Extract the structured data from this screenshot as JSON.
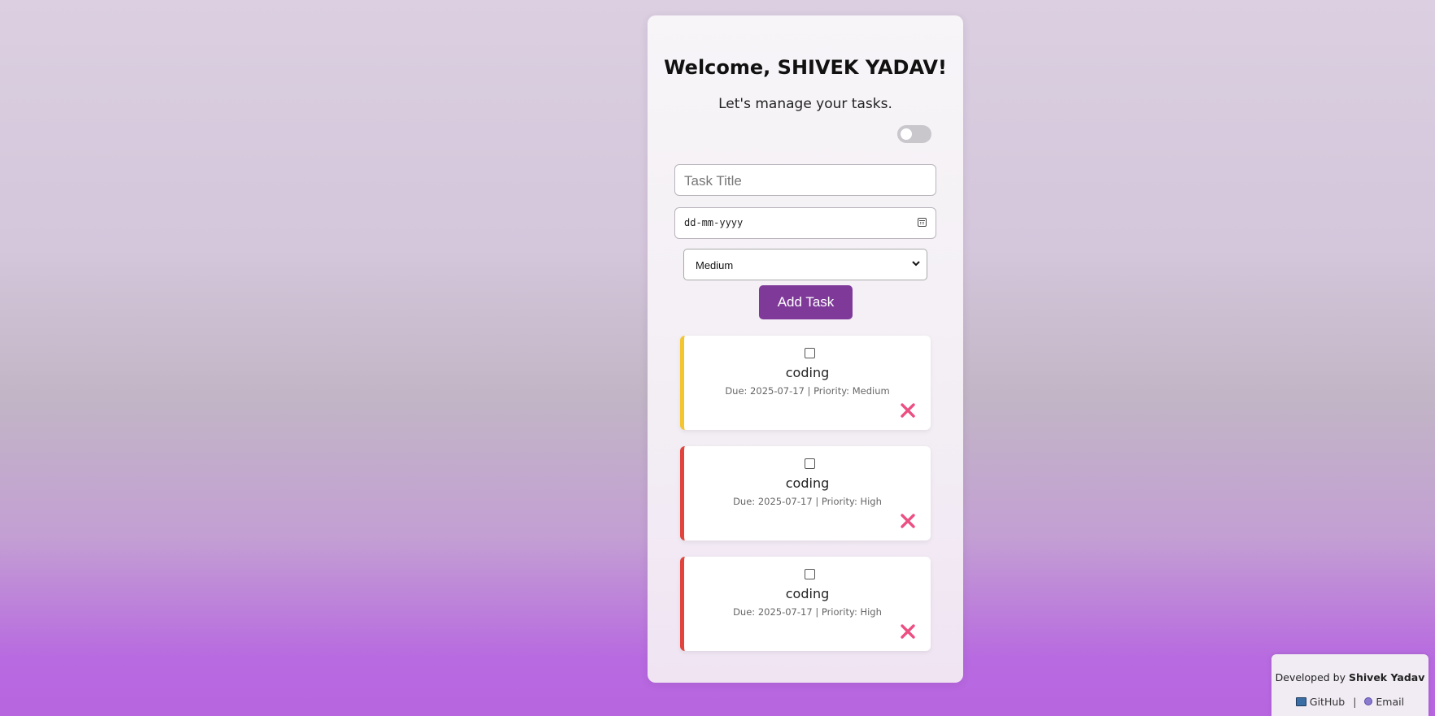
{
  "header": {
    "title": "Welcome, SHIVEK YADAV!",
    "subtitle": "Let's manage your tasks."
  },
  "theme_toggle": {
    "state": "off",
    "icon": "toggle-switch"
  },
  "form": {
    "task_title_placeholder": "Task Title",
    "date_placeholder": "dd-mm-yyyy",
    "priority_selected": "Medium",
    "add_button_label": "Add Task"
  },
  "tasks": [
    {
      "title": "coding",
      "meta": "Due: 2025-07-17 | Priority: Medium",
      "priority": "Medium",
      "color": "#f3c531"
    },
    {
      "title": "coding",
      "meta": "Due: 2025-07-17 | Priority: High",
      "priority": "High",
      "color": "#e0443c"
    },
    {
      "title": "coding",
      "meta": "Due: 2025-07-17 | Priority: High",
      "priority": "High",
      "color": "#e0443c"
    }
  ],
  "footer": {
    "developed_by": "Developed by",
    "developer": "Shivek Yadav",
    "github_label": "GitHub",
    "separator": "|",
    "email_label": "Email"
  },
  "colors": {
    "accent": "#7f3a99",
    "delete": "#ec4f82",
    "priority_medium": "#f3c531",
    "priority_high": "#e0443c"
  }
}
